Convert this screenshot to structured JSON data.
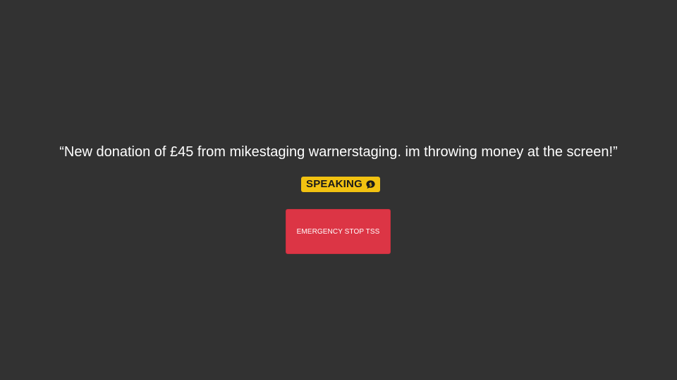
{
  "tts": {
    "message": "“New donation of £45 from mikestaging warnerstaging. im throwing money at the screen!”",
    "status_label": "SPEAKING",
    "status_icon": "speech-bubble-dollar-icon",
    "emergency_stop_label": "EMERGENCY STOP TSS"
  },
  "colors": {
    "background": "#323232",
    "badge": "#f2c211",
    "stop_button": "#dc3545",
    "text": "#ffffff"
  }
}
